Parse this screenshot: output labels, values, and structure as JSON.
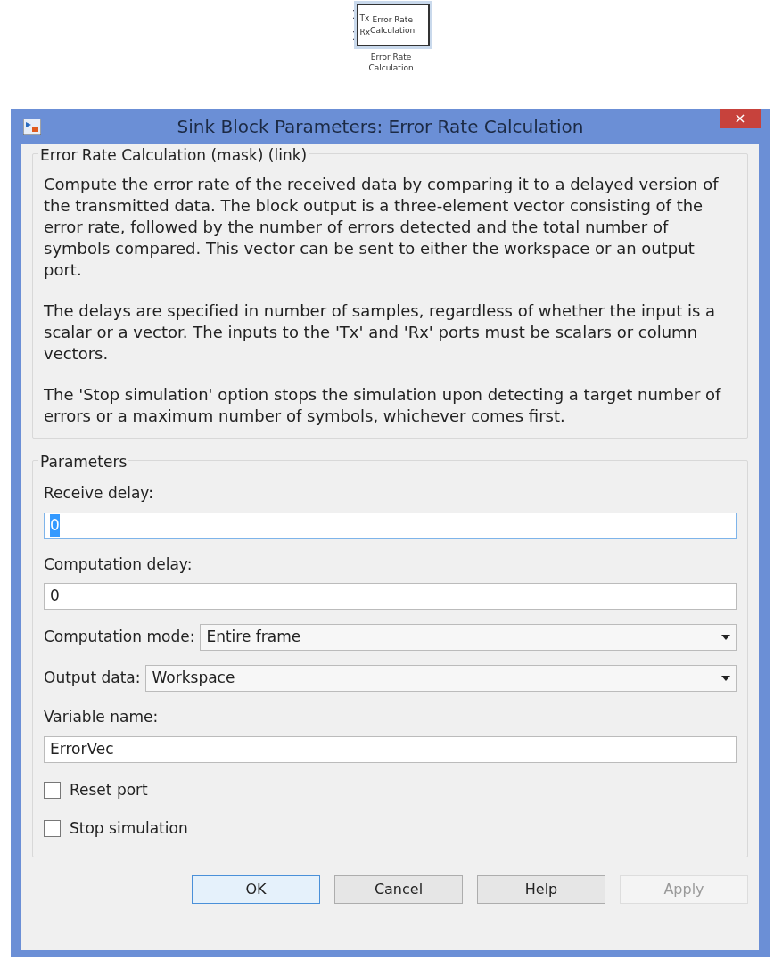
{
  "block": {
    "ports": [
      "Tx",
      "Rx"
    ],
    "title_lines": [
      "Error Rate",
      "Calculation"
    ],
    "label_lines": [
      "Error Rate",
      "Calculation"
    ]
  },
  "window": {
    "title": "Sink Block Parameters: Error Rate Calculation",
    "close": "×"
  },
  "description": {
    "title": "Error Rate Calculation (mask) (link)",
    "paragraphs": [
      "Compute the error rate of the received data by comparing it to a delayed version of the transmitted data. The block output is a three-element vector consisting of the error rate, followed by the number of errors detected and the total number of symbols compared. This vector can be sent to either the workspace or an output port.",
      "The delays are specified in number of samples, regardless of whether the input is a scalar or a vector. The inputs to the 'Tx' and 'Rx' ports must be scalars or column vectors.",
      "The 'Stop simulation' option stops the simulation upon detecting a target number of errors or a maximum number of symbols, whichever comes first."
    ]
  },
  "parameters": {
    "title": "Parameters",
    "items": [
      {
        "kind": "text",
        "label": "Receive delay:",
        "value": "0",
        "focused": true
      },
      {
        "kind": "text",
        "label": "Computation delay:",
        "value": "0",
        "focused": false
      },
      {
        "kind": "dropdown",
        "label": "Computation mode:",
        "value": "Entire frame"
      },
      {
        "kind": "dropdown",
        "label": "Output data:",
        "value": "Workspace"
      },
      {
        "kind": "text",
        "label": "Variable name:",
        "value": "ErrorVec",
        "focused": false
      },
      {
        "kind": "checkbox",
        "label": "Reset port",
        "checked": false
      },
      {
        "kind": "checkbox",
        "label": "Stop simulation",
        "checked": false
      }
    ]
  },
  "buttons": [
    {
      "label": "OK",
      "default": true,
      "disabled": false
    },
    {
      "label": "Cancel",
      "default": false,
      "disabled": false
    },
    {
      "label": "Help",
      "default": false,
      "disabled": false
    },
    {
      "label": "Apply",
      "default": false,
      "disabled": true
    }
  ]
}
